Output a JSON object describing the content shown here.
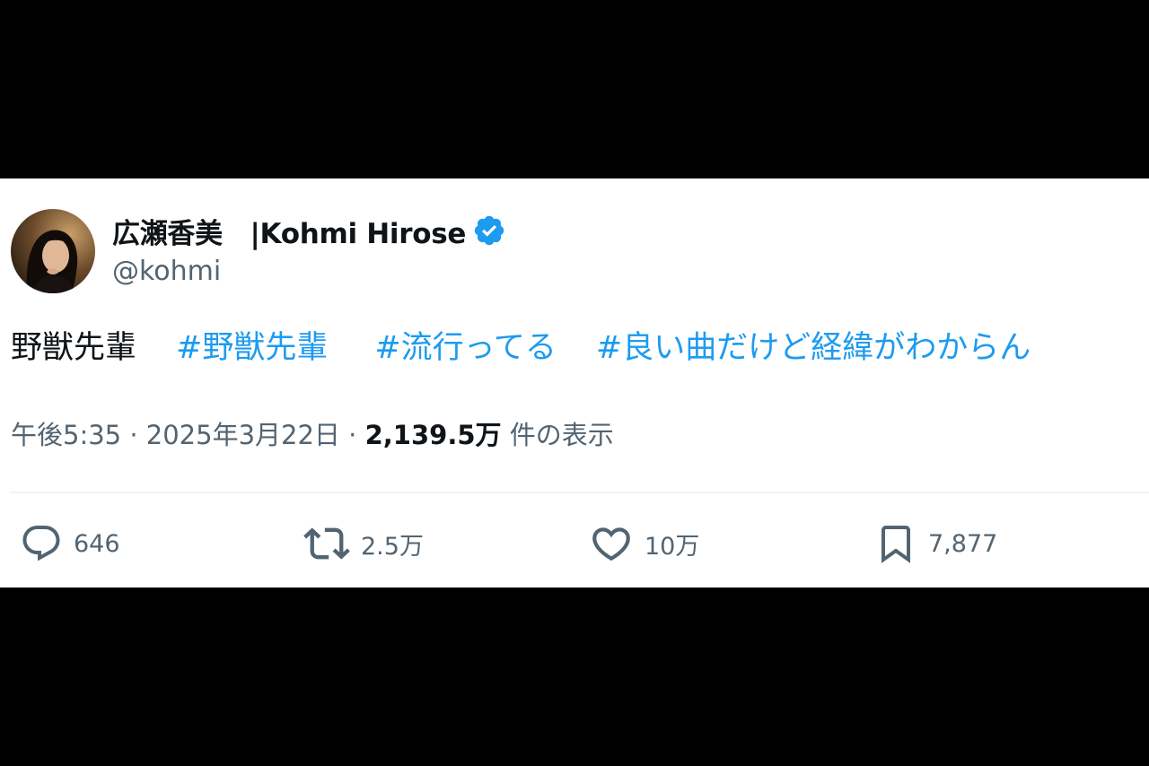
{
  "tweet": {
    "author": {
      "display_name": "広瀬香美　|Kohmi Hirose",
      "handle": "@kohmi",
      "verified": true
    },
    "text": {
      "plain": "野獣先輩",
      "hashtags": [
        "#野獣先輩",
        "#流行ってる",
        "#良い曲だけど経緯がわからん"
      ]
    },
    "meta": {
      "time": "午後5:35",
      "date": "2025年3月22日",
      "views_count": "2,139.5万",
      "views_label": "件の表示"
    },
    "actions": {
      "replies": "646",
      "retweets": "2.5万",
      "likes": "10万",
      "bookmarks": "7,877"
    }
  },
  "colors": {
    "text_primary": "#0f1419",
    "text_secondary": "#536471",
    "accent": "#1d9bf0",
    "divider": "#eff3f4",
    "letterbox": "#000000"
  },
  "icons": [
    "verified-badge-icon",
    "reply-icon",
    "retweet-icon",
    "like-icon",
    "bookmark-icon"
  ]
}
